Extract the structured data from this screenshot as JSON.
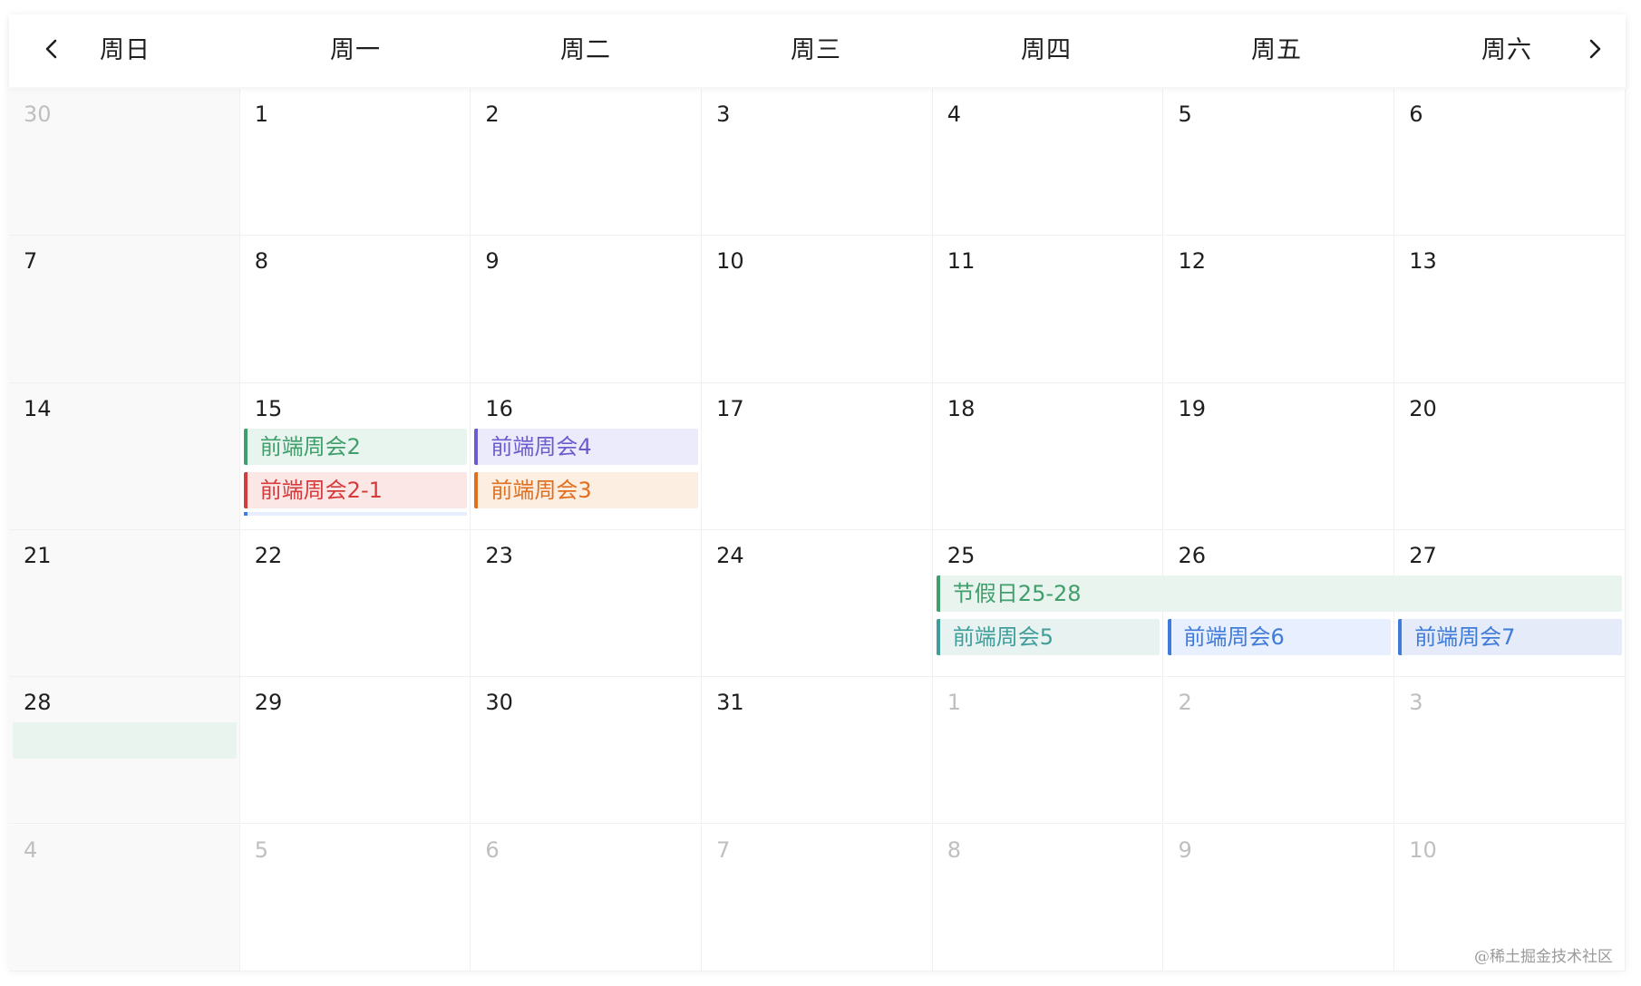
{
  "weekdays": [
    "周日",
    "周一",
    "周二",
    "周三",
    "周四",
    "周五",
    "周六"
  ],
  "weeks": [
    [
      {
        "d": "30",
        "o": true
      },
      {
        "d": "1"
      },
      {
        "d": "2"
      },
      {
        "d": "3"
      },
      {
        "d": "4"
      },
      {
        "d": "5"
      },
      {
        "d": "6"
      }
    ],
    [
      {
        "d": "7"
      },
      {
        "d": "8"
      },
      {
        "d": "9"
      },
      {
        "d": "10"
      },
      {
        "d": "11"
      },
      {
        "d": "12"
      },
      {
        "d": "13"
      }
    ],
    [
      {
        "d": "14"
      },
      {
        "d": "15"
      },
      {
        "d": "16"
      },
      {
        "d": "17"
      },
      {
        "d": "18"
      },
      {
        "d": "19"
      },
      {
        "d": "20"
      }
    ],
    [
      {
        "d": "21"
      },
      {
        "d": "22"
      },
      {
        "d": "23"
      },
      {
        "d": "24"
      },
      {
        "d": "25"
      },
      {
        "d": "26"
      },
      {
        "d": "27"
      }
    ],
    [
      {
        "d": "28"
      },
      {
        "d": "29"
      },
      {
        "d": "30"
      },
      {
        "d": "31"
      },
      {
        "d": "1",
        "o": true
      },
      {
        "d": "2",
        "o": true
      },
      {
        "d": "3",
        "o": true
      }
    ],
    [
      {
        "d": "4",
        "o": true
      },
      {
        "d": "5",
        "o": true
      },
      {
        "d": "6",
        "o": true
      },
      {
        "d": "7",
        "o": true
      },
      {
        "d": "8",
        "o": true
      },
      {
        "d": "9",
        "o": true
      },
      {
        "d": "10",
        "o": true
      }
    ]
  ],
  "events": [
    {
      "title": "前端周会2",
      "week": 2,
      "col": 1,
      "span": 1,
      "lane": 0,
      "color": "#3f9e6b",
      "bg": "#e8f5ee"
    },
    {
      "title": "前端周会4",
      "week": 2,
      "col": 2,
      "span": 1,
      "lane": 0,
      "color": "#6a5ccf",
      "bg": "#ecebfc"
    },
    {
      "title": "前端周会2-1",
      "week": 2,
      "col": 1,
      "span": 1,
      "lane": 1,
      "color": "#d63b3b",
      "bg": "#fce7e7"
    },
    {
      "title": "前端周会3",
      "week": 2,
      "col": 2,
      "span": 1,
      "lane": 1,
      "color": "#e06f1f",
      "bg": "#fdeee2"
    },
    {
      "title": "节假日25-28",
      "week": 3,
      "col": 4,
      "span": 3,
      "lane": 0,
      "color": "#3f9e6b",
      "bg": "#eaf4ef"
    },
    {
      "title": "前端周会5",
      "week": 3,
      "col": 4,
      "span": 1,
      "lane": 1,
      "color": "#3f9e9a",
      "bg": "#e8f3f1"
    },
    {
      "title": "前端周会6",
      "week": 3,
      "col": 5,
      "span": 1,
      "lane": 1,
      "color": "#3f7bd9",
      "bg": "#e8efff"
    },
    {
      "title": "前端周会7",
      "week": 3,
      "col": 6,
      "span": 1,
      "lane": 1,
      "color": "#3f7bd9",
      "bg": "#e5ebf9"
    },
    {
      "title": "",
      "week": 4,
      "col": 0,
      "span": 1,
      "lane": 0,
      "color": "#3f9e6b",
      "bg": "#eaf4ef",
      "continued": true
    }
  ],
  "watermark": "@稀土掘金技术社区"
}
